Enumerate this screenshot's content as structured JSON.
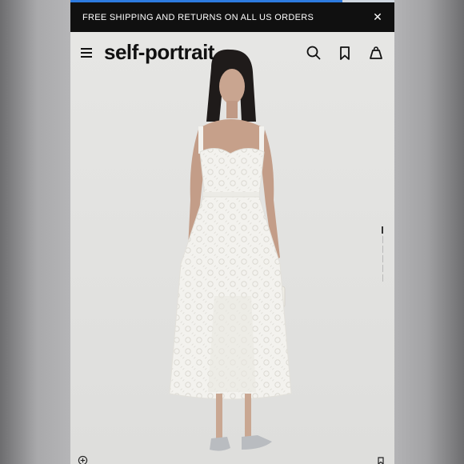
{
  "announcement": {
    "text": "FREE SHIPPING AND RETURNS ON ALL US ORDERS",
    "close_icon": "close-icon"
  },
  "progress": {
    "fraction": 0.84,
    "color": "#2d7be0"
  },
  "header": {
    "logo": "self-portrait",
    "menu_icon": "hamburger-icon",
    "search_icon": "search-icon",
    "bookmark_icon": "bookmark-icon",
    "bag_icon": "bag-icon"
  },
  "product_image": {
    "description_icon": "product-photo",
    "colors": {
      "background": "#e7e7e5",
      "dress": "#f4f3ef"
    }
  },
  "gallery": {
    "total": 6,
    "current": 1
  },
  "bottom": {
    "zoom_icon": "zoom-plus-icon",
    "save_icon": "bookmark-icon"
  }
}
